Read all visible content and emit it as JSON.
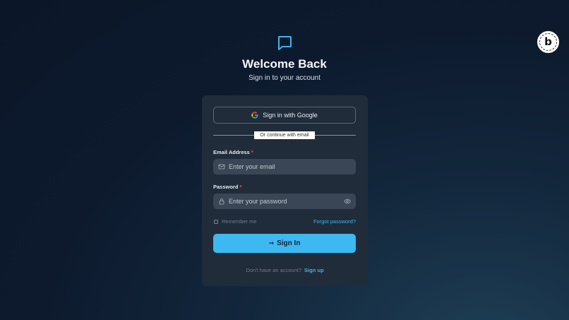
{
  "header": {
    "logo_icon": "chat-bubble-icon",
    "title": "Welcome Back",
    "subtitle": "Sign in to your account"
  },
  "badge": {
    "icon": "b-logo-badge-icon"
  },
  "card": {
    "google_button_label": "Sign in with Google",
    "divider_text": "Or continue with email",
    "email": {
      "label": "Email Address",
      "required_mark": "*",
      "placeholder": "Enter your email",
      "value": "",
      "icon": "mail-icon"
    },
    "password": {
      "label": "Password",
      "required_mark": "*",
      "placeholder": "Enter your password",
      "value": "",
      "icon": "lock-icon",
      "toggle_icon": "eye-icon"
    },
    "remember_label": "Remember me",
    "remember_checked": false,
    "forgot_label": "Forgot password?",
    "signin_label": "Sign In",
    "signin_icon": "arrow-right-icon",
    "signup_prompt": "Don't have an account?",
    "signup_link": "Sign up"
  },
  "colors": {
    "accent": "#3eb8f0",
    "link": "#3fb5ec",
    "card_bg": "#202c3a",
    "required": "#e85a5a"
  }
}
